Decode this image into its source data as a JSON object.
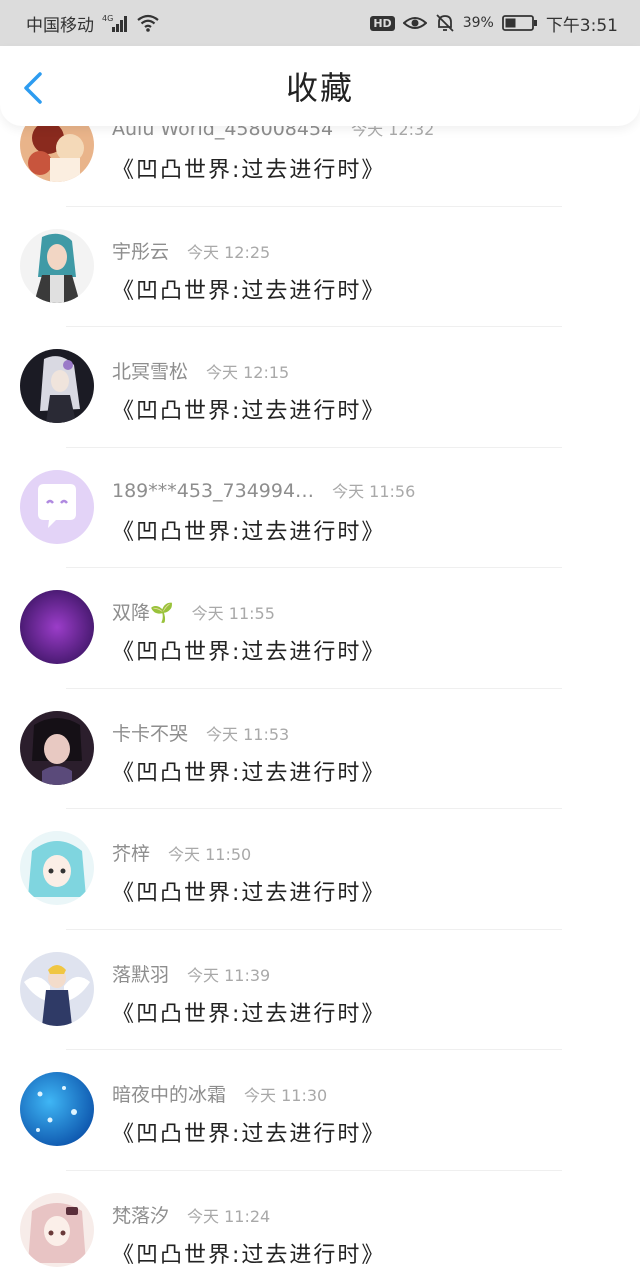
{
  "status": {
    "carrier": "中国移动",
    "network": "4G",
    "hd": "HD",
    "battery": "39%",
    "time": "下午3:51"
  },
  "header": {
    "title": "收藏",
    "back_icon": "chevron-left-icon"
  },
  "colors": {
    "accent": "#2d9cf0",
    "status_bg": "#dcdcdc",
    "text_primary": "#222222",
    "text_secondary": "#8e8e8e"
  },
  "items": [
    {
      "user": "Aulu World_458008454",
      "time": "今天 12:32",
      "title": "《凹凸世界:过去进行时》",
      "avatar": "avatar-anime-orange"
    },
    {
      "user": "宇彤云",
      "time": "今天 12:25",
      "title": "《凹凸世界:过去进行时》",
      "avatar": "avatar-anime-teal-hair"
    },
    {
      "user": "北冥雪松",
      "time": "今天 12:15",
      "title": "《凹凸世界:过去进行时》",
      "avatar": "avatar-anime-dark"
    },
    {
      "user": "189***453_734994…",
      "time": "今天 11:56",
      "title": "《凹凸世界:过去进行时》",
      "avatar": "avatar-chat-bubble"
    },
    {
      "user": "双降🌱",
      "time": "今天 11:55",
      "title": "《凹凸世界:过去进行时》",
      "avatar": "avatar-purple-galaxy"
    },
    {
      "user": "卡卡不哭",
      "time": "今天 11:53",
      "title": "《凹凸世界:过去进行时》",
      "avatar": "avatar-anime-dark-hair"
    },
    {
      "user": "芥梓",
      "time": "今天 11:50",
      "title": "《凹凸世界:过去进行时》",
      "avatar": "avatar-anime-cyan"
    },
    {
      "user": "落默羽",
      "time": "今天 11:39",
      "title": "《凹凸世界:过去进行时》",
      "avatar": "avatar-anime-angel"
    },
    {
      "user": "暗夜中的冰霜",
      "time": "今天 11:30",
      "title": "《凹凸世界:过去进行时》",
      "avatar": "avatar-blue-sparkle"
    },
    {
      "user": "梵落汐",
      "time": "今天 11:24",
      "title": "《凹凸世界:过去进行时》",
      "avatar": "avatar-anime-pink"
    }
  ]
}
